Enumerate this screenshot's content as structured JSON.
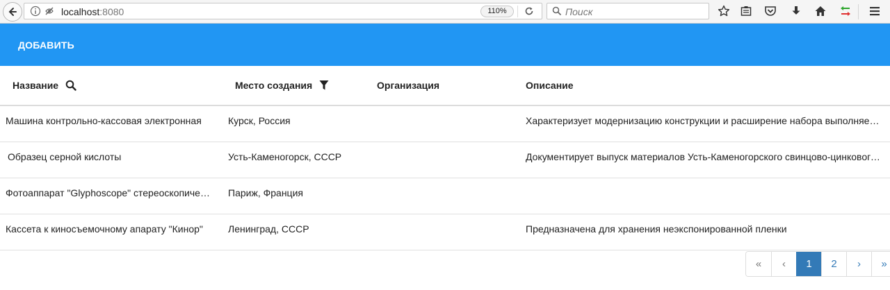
{
  "browser": {
    "url_host": "localhost",
    "url_port": ":8080",
    "zoom": "110%",
    "search_placeholder": "Поиск"
  },
  "toolbar": {
    "add_label": "ДОБАВИТЬ"
  },
  "table": {
    "columns": [
      "Название",
      "Место создания",
      "Организация",
      "Описание"
    ],
    "rows": [
      {
        "name": "Машина контрольно-кассовая электронная",
        "place": "Курск, Россия",
        "org": "",
        "desc": "Характеризует модернизацию конструкции и расширение набора выполняемых функций"
      },
      {
        "name": "Образец серной кислоты",
        "place": "Усть-Каменогорск, СССР",
        "org": "",
        "desc": "Документирует выпуск материалов Усть-Каменогорского свинцово-цинкового комбината"
      },
      {
        "name": "Фотоаппарат \"Glyphoscope\" стереоскопический",
        "place": "Париж, Франция",
        "org": "",
        "desc": ""
      },
      {
        "name": "Кассета к киносъемочному апарату \"Кинор\"",
        "place": "Ленинград, СССР",
        "org": "",
        "desc": "Предназначена для хранения неэкспонированной пленки"
      }
    ]
  },
  "pagination": {
    "first": "«",
    "prev": "‹",
    "pages": [
      "1",
      "2"
    ],
    "current": "1",
    "next": "›",
    "last": "»"
  },
  "colors": {
    "appbar": "#2196f3",
    "page_active": "#337ab7"
  }
}
